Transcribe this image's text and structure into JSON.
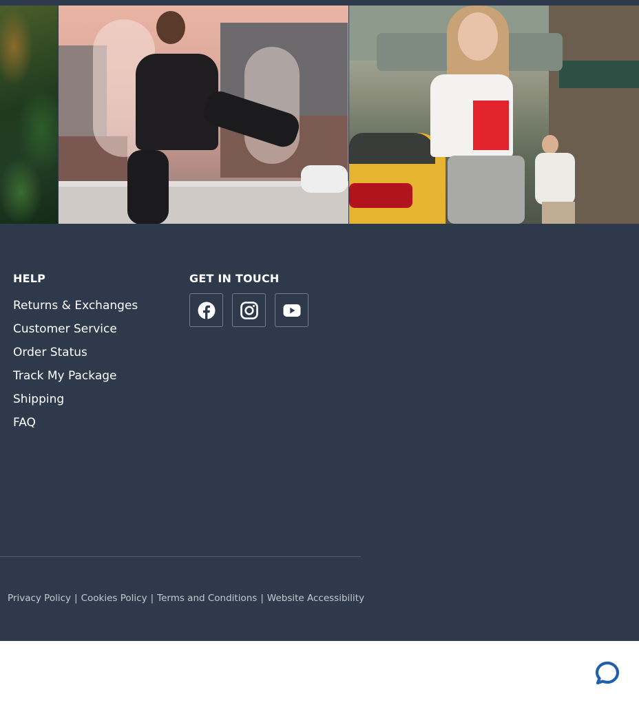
{
  "footer": {
    "help": {
      "heading": "HELP",
      "links": [
        {
          "label": "Returns & Exchanges"
        },
        {
          "label": "Customer Service"
        },
        {
          "label": "Order Status"
        },
        {
          "label": "Track My Package"
        },
        {
          "label": "Shipping"
        },
        {
          "label": "FAQ"
        }
      ]
    },
    "get_in_touch": {
      "heading": "GET IN TOUCH",
      "social": [
        {
          "icon": "facebook-icon"
        },
        {
          "icon": "instagram-icon"
        },
        {
          "icon": "youtube-icon"
        }
      ]
    },
    "legal": {
      "privacy_policy": "Privacy Policy",
      "cookies_policy": "Cookies Policy",
      "terms": "Terms and Conditions",
      "accessibility": "Website Accessibility",
      "separator": "|"
    }
  },
  "chat": {
    "icon": "chat-bubble-icon"
  },
  "colors": {
    "footer_bg": "#2e3a4c",
    "text": "#ffffff",
    "legal_text": "#c3c8d1",
    "chat_accent": "#1f5fae"
  }
}
